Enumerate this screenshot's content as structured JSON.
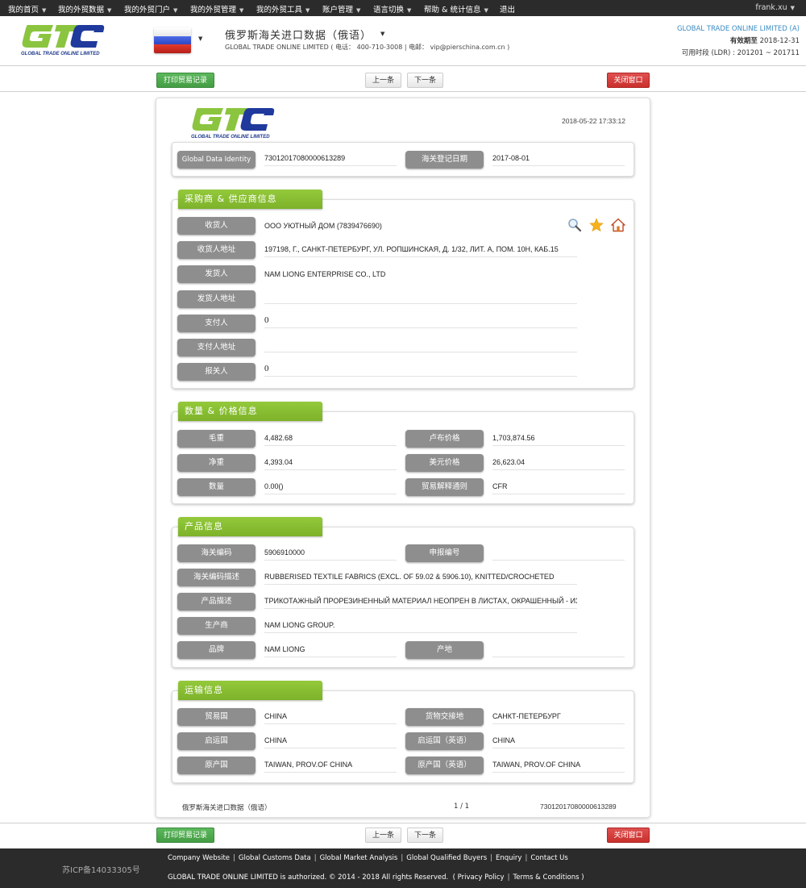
{
  "topnav": {
    "items": [
      {
        "label": "我的首页"
      },
      {
        "label": "我的外贸数据"
      },
      {
        "label": "我的外贸门户"
      },
      {
        "label": "我的外贸管理"
      },
      {
        "label": "我的外贸工具"
      },
      {
        "label": "账户管理"
      },
      {
        "label": "语言切换"
      },
      {
        "label": "帮助 & 统计信息"
      },
      {
        "label": "退出"
      }
    ],
    "user": "frank.xu"
  },
  "header": {
    "logo_text": "GTO",
    "logo_subtitle": "GLOBAL TRADE ONLINE LIMITED",
    "flag_country": "Russia",
    "flag_colors": [
      "#ffffff",
      "#3a56d8",
      "#d52b1e"
    ],
    "title": "俄罗斯海关进口数据（俄语）",
    "company": "GLOBAL TRADE ONLINE LIMITED",
    "phone_label": "电话：",
    "phone": "400-710-3008",
    "email_label": "电邮：",
    "email": "vip@pierschina.com.cn",
    "account_name": "GLOBAL TRADE ONLINE LIMITED (A)",
    "valid_until_label": "有效期至",
    "valid_until": "2018-12-31",
    "available_period_label": "可用时段 (LDR) :",
    "available_period": "201201 ~ 201711"
  },
  "toolbar": {
    "print_label": "打印贸易记录",
    "prev_label": "上一条",
    "next_label": "下一条",
    "close_label": "关闭窗口"
  },
  "record": {
    "timestamp": "2018-05-22 17:33:12",
    "identity": {
      "global_id_label": "Global Data Identity",
      "global_id": "73012017080000613289",
      "reg_date_label": "海关登记日期",
      "reg_date": "2017-08-01"
    },
    "parties": {
      "title": "采购商 & 供应商信息",
      "consignee_label": "收货人",
      "consignee": "ООО УЮТНЫЙ ДОМ (7839476690)",
      "consignee_addr_label": "收货人地址",
      "consignee_addr": "197198, Г., САНКТ-ПЕТЕРБУРГ, УЛ. РОПШИНСКАЯ, Д. 1/32, ЛИТ. А, ПОМ. 10Н, КАБ.15",
      "shipper_label": "发货人",
      "shipper": "NAM LIONG ENTERPRISE CO., LTD",
      "shipper_addr_label": "发货人地址",
      "shipper_addr": "",
      "payer_label": "支付人",
      "payer": "0",
      "payer_addr_label": "支付人地址",
      "payer_addr": "",
      "declarant_label": "报关人",
      "declarant": "0",
      "icons": [
        "search-icon",
        "star-icon",
        "home-icon"
      ]
    },
    "quantity": {
      "title": "数量 & 价格信息",
      "gross_label": "毛重",
      "gross": "4,482.68",
      "rub_label": "卢布价格",
      "rub": "1,703,874.56",
      "net_label": "净重",
      "net": "4,393.04",
      "usd_label": "美元价格",
      "usd": "26,623.04",
      "qty_label": "数量",
      "qty": "0.00()",
      "terms_label": "贸易解释通则",
      "terms": "CFR"
    },
    "product": {
      "title": "产品信息",
      "hs_label": "海关编码",
      "hs": "5906910000",
      "decl_no_label": "申报编号",
      "decl_no": "",
      "hs_desc_label": "海关编码描述",
      "hs_desc": "RUBBERISED TEXTILE FABRICS (EXCL. OF 59.02 & 5906.10), KNITTED/CROCHETED",
      "prod_desc_label": "产品描述",
      "prod_desc": "ТРИКОТАЖНЫЙ ПРОРЕЗИНЕННЫЙ МАТЕРИАЛ НЕОПРЕН В ЛИСТАХ, ОКРАШЕННЫЙ - ИЗ",
      "maker_label": "生产商",
      "maker": "NAM LIONG GROUP.",
      "brand_label": "品牌",
      "brand": "NAM LIONG",
      "origin_place_label": "产地",
      "origin_place": ""
    },
    "transport": {
      "title": "运输信息",
      "trade_country_label": "贸易国",
      "trade_country": "CHINA",
      "delivery_place_label": "货物交接地",
      "delivery_place": "САНКТ-ПЕТЕРБУРГ",
      "depart_label": "启运国",
      "depart": "CHINA",
      "depart_en_label": "启运国（英语）",
      "depart_en": "CHINA",
      "origin_label": "原产国",
      "origin": "TAIWAN, PROV.OF CHINA",
      "origin_en_label": "原产国（英语）",
      "origin_en": "TAIWAN, PROV.OF CHINA"
    },
    "footer": {
      "source": "俄罗斯海关进口数据（俄语）",
      "page": "1 / 1",
      "id": "73012017080000613289"
    }
  },
  "footer": {
    "icp": "苏ICP备14033305号",
    "links": [
      "Company Website",
      "Global Customs Data",
      "Global Market Analysis",
      "Global Qualified Buyers",
      "Enquiry",
      "Contact Us"
    ],
    "copyright": "GLOBAL TRADE ONLINE LIMITED is authorized. © 2014 - 2018 All rights Reserved.",
    "privacy": "Privacy Policy",
    "terms": "Terms & Conditions"
  },
  "colors": {
    "nav_bg": "#2b2b2b",
    "section_green": "#86bd30",
    "label_gray": "#8e8e8e",
    "btn_green": "#4cae4c",
    "btn_red": "#d43f3a",
    "link_blue": "#3a8cc4"
  }
}
